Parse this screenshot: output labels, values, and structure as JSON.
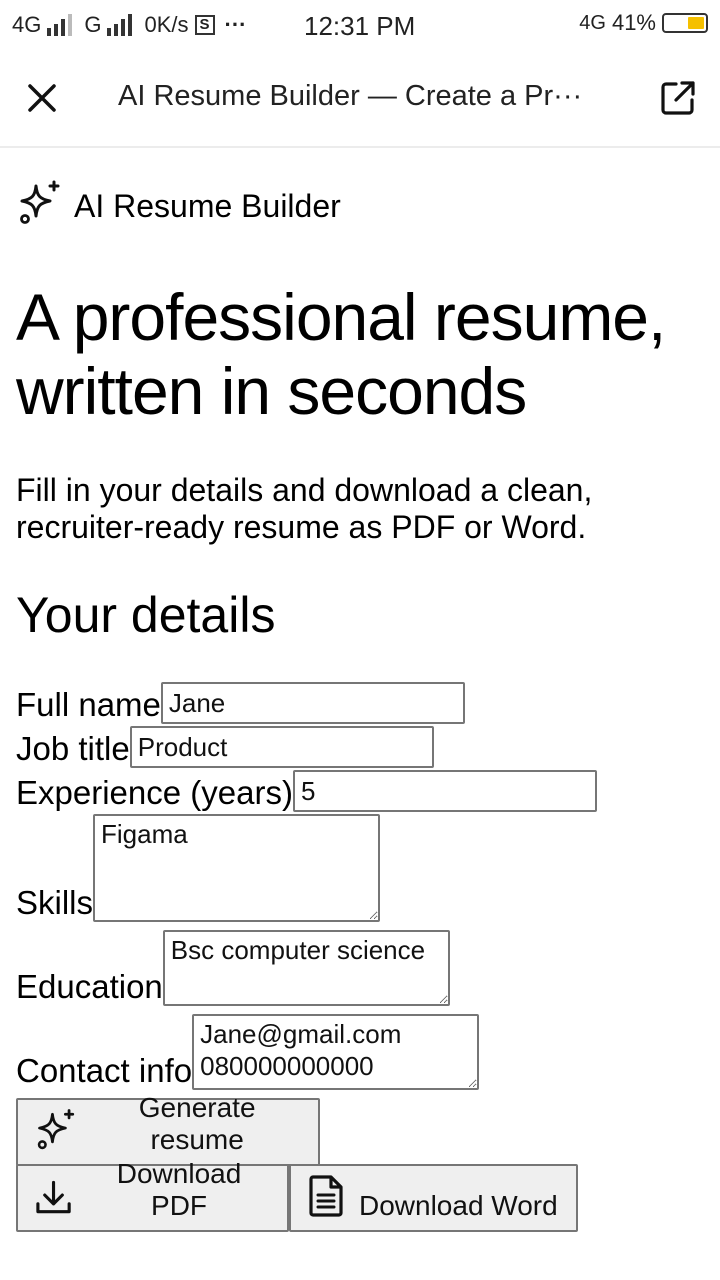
{
  "status_bar": {
    "left_text_1": "4G",
    "left_text_2": "G",
    "speed": "0K/s",
    "s_icon": "S",
    "dots": "···",
    "time": "12:31 PM",
    "network": "4G",
    "battery": "41%",
    "battery_level": 0.41
  },
  "toolbar": {
    "title": "AI Resume Builder — Create a Pr···",
    "close_icon": "close-icon",
    "external_icon": "open-external-icon"
  },
  "brand": {
    "name": "AI Resume Builder",
    "icon": "sparkles-icon"
  },
  "hero": {
    "title": "A professional resume, written in seconds",
    "lead": "Fill in your details and download a clean, recruiter-ready resume as PDF or Word."
  },
  "form": {
    "heading": "Your details",
    "full_name": {
      "label": "Full name",
      "value": "Jane"
    },
    "job_title": {
      "label": "Job title",
      "value": "Product"
    },
    "experience": {
      "label": "Experience (years)",
      "value": "5"
    },
    "skills": {
      "label": "Skills",
      "value": "Figama"
    },
    "education": {
      "label": "Education",
      "value": "Bsc computer science"
    },
    "contact": {
      "label": "Contact info",
      "value": "Jane@gmail.com\n080000000000"
    }
  },
  "buttons": {
    "generate": "Generate resume",
    "download_pdf": "Download PDF",
    "download_word": "Download Word"
  }
}
